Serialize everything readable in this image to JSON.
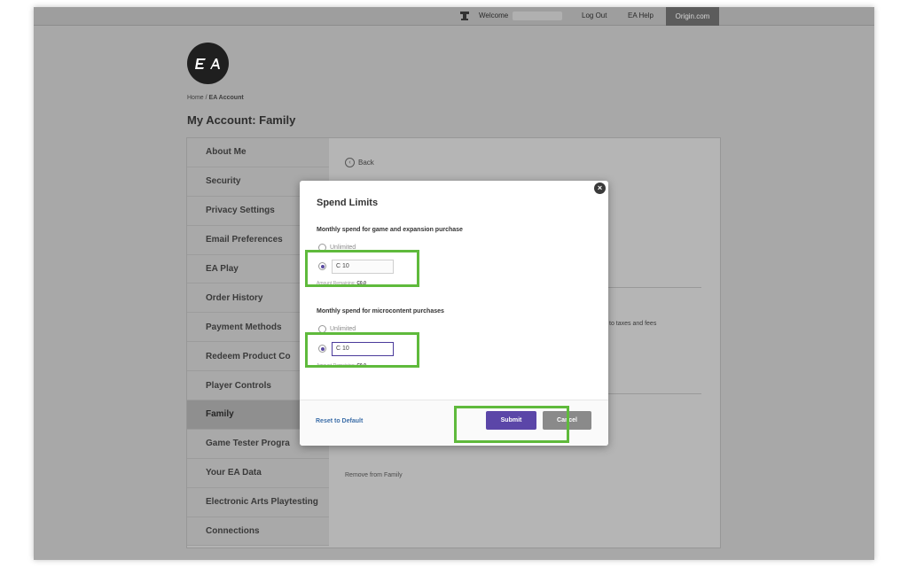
{
  "topbar": {
    "welcome": "Welcome",
    "logout": "Log Out",
    "help": "EA Help",
    "origin": "Origin.com"
  },
  "logo_text": "EA",
  "breadcrumb": {
    "home": "Home",
    "sep": " / ",
    "current": "EA Account"
  },
  "page_title": "My Account: Family",
  "sidebar": {
    "items": [
      {
        "label": "About Me"
      },
      {
        "label": "Security"
      },
      {
        "label": "Privacy Settings"
      },
      {
        "label": "Email Preferences"
      },
      {
        "label": "EA Play"
      },
      {
        "label": "Order History"
      },
      {
        "label": "Payment Methods"
      },
      {
        "label": "Redeem Product Co"
      },
      {
        "label": "Player Controls"
      },
      {
        "label": "Family"
      },
      {
        "label": "Game Tester Progra"
      },
      {
        "label": "Your EA Data"
      },
      {
        "label": "Electronic Arts Playtesting"
      },
      {
        "label": "Connections"
      }
    ]
  },
  "content": {
    "back": "Back",
    "taxes_note": "to taxes and fees",
    "remove": "Remove from Family"
  },
  "modal": {
    "title": "Spend Limits",
    "game": {
      "label": "Monthly spend for game and expansion purchase",
      "unlimited": "Unlimited",
      "value": "C 10",
      "remaining_label": "Amount Remaining:",
      "remaining_value": "C0.0"
    },
    "micro": {
      "label": "Monthly spend for microcontent purchases",
      "unlimited": "Unlimited",
      "value": "C 10",
      "remaining_label": "Amount Remaining:",
      "remaining_value": "C0.0"
    },
    "reset": "Reset to Default",
    "submit": "Submit",
    "cancel": "Cancel",
    "close_glyph": "×"
  },
  "colors": {
    "highlight": "#5fba3c",
    "submit": "#5b46a8",
    "link": "#3c6ea8"
  }
}
